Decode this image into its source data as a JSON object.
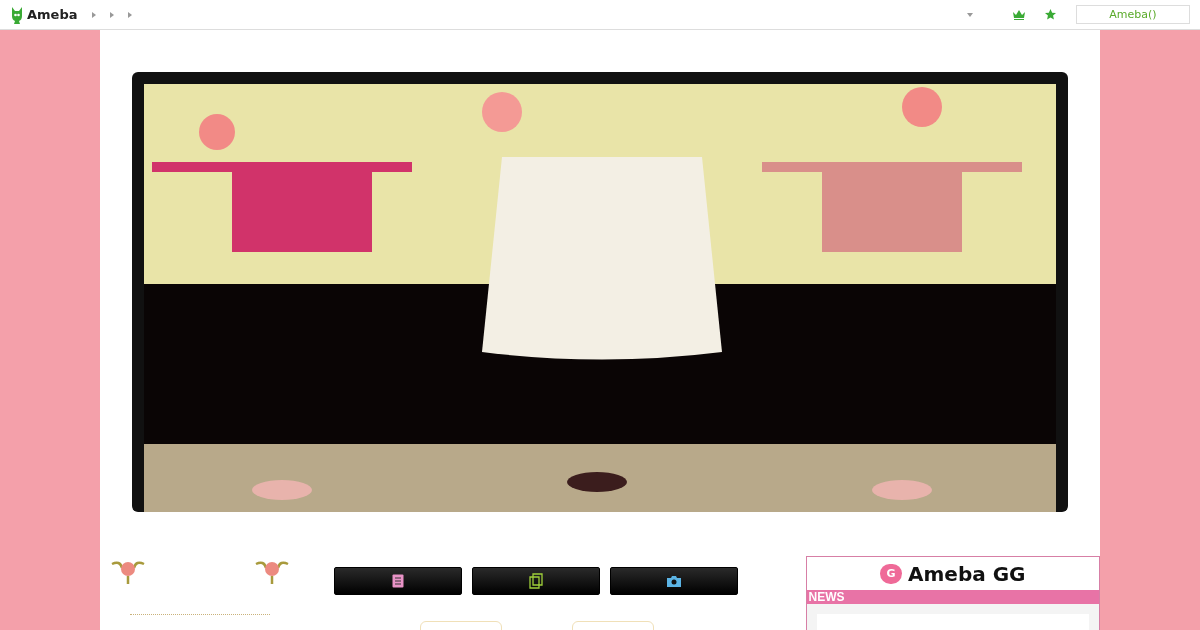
{
  "top_bar": {
    "logo": "Ameba",
    "login_button": "Ameba()"
  },
  "nav_buttons": [
    {
      "kind": "list"
    },
    {
      "kind": "pages"
    },
    {
      "kind": "camera"
    }
  ],
  "gg_widget": {
    "badge": "G",
    "title": "Ameba GG",
    "section": "NEWS"
  }
}
